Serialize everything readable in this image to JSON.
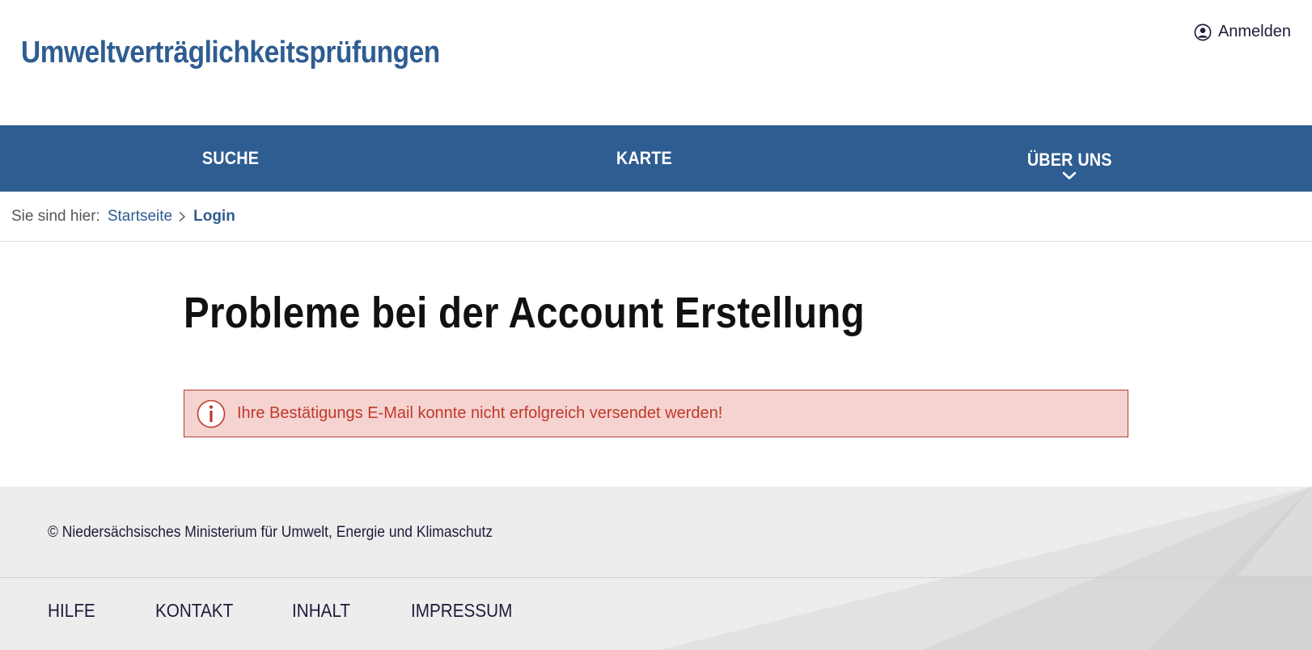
{
  "header": {
    "site_title": "Umweltverträglichkeitsprüfungen",
    "login_label": "Anmelden",
    "login_icon": "user-circle-icon"
  },
  "nav": {
    "items": [
      {
        "label": "SUCHE"
      },
      {
        "label": "KARTE"
      },
      {
        "label": "ÜBER UNS",
        "icon": "chevron-down-icon"
      }
    ]
  },
  "breadcrumb": {
    "prefix": "Sie sind hier:",
    "home": "Startseite",
    "current": "Login",
    "separator_icon": "chevron-right-icon"
  },
  "main": {
    "heading": "Probleme bei der Account Erstellung",
    "alert": {
      "icon": "info-icon",
      "message": "Ihre Bestätigungs E-Mail konnte nicht erfolgreich versendet werden!"
    }
  },
  "footer": {
    "copyright": "© Niedersächsisches Ministerium für Umwelt, Energie und Klimaschutz",
    "links": [
      {
        "label": "HILFE"
      },
      {
        "label": "KONTAKT"
      },
      {
        "label": "INHALT"
      },
      {
        "label": "IMPRESSUM"
      }
    ]
  },
  "colors": {
    "brand_blue": "#2e5d91",
    "alert_bg": "#f5d3d0",
    "alert_text": "#c0392b",
    "footer_bg": "#ededed"
  }
}
